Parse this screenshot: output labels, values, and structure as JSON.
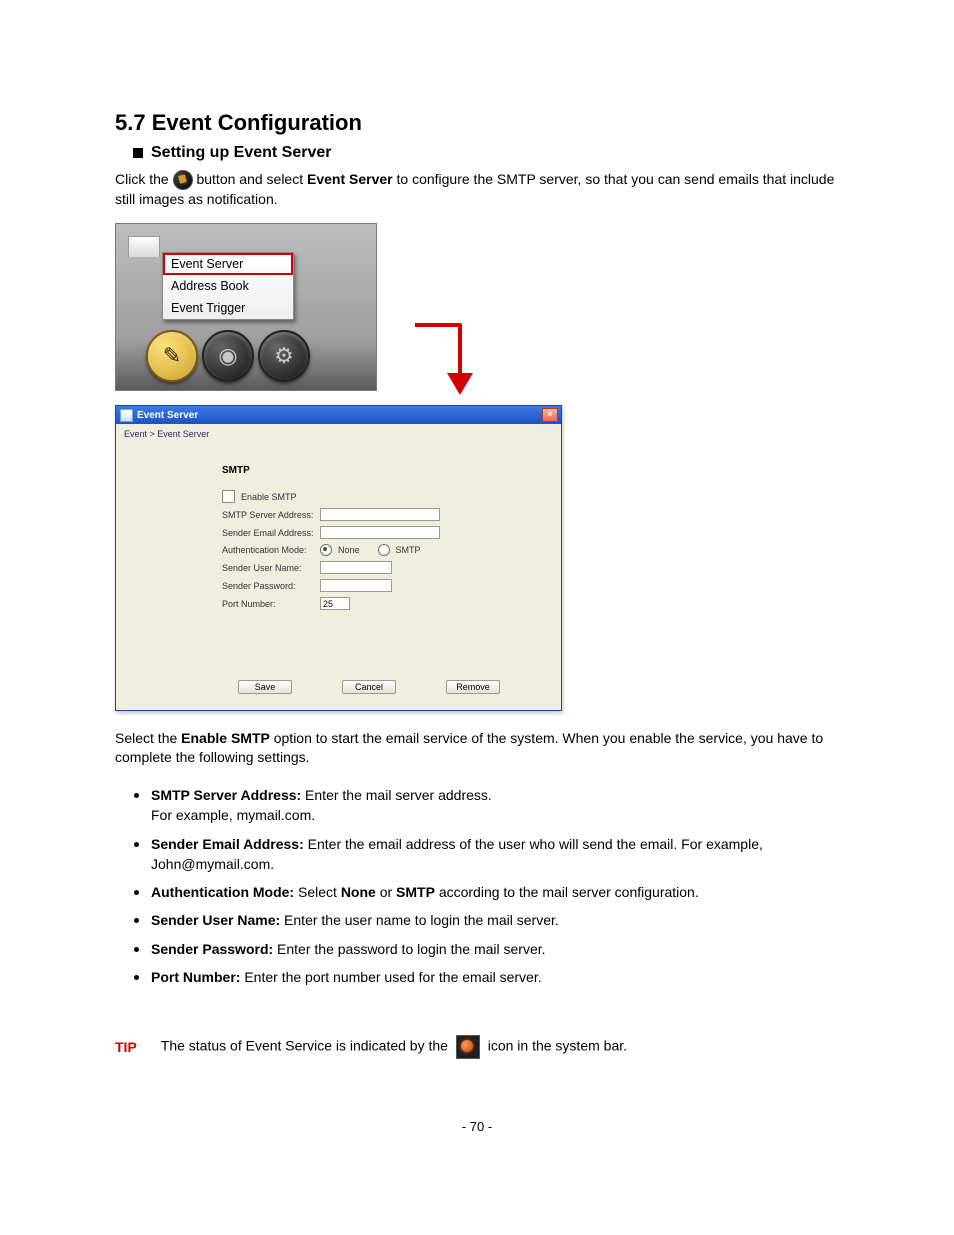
{
  "section": {
    "title": "5.7  Event Configuration",
    "sub_title": "Setting up Event Server",
    "intro_pre": "Click the ",
    "intro_mid": " button and select ",
    "intro_menu": "Event Server",
    "intro_post": " to configure the SMTP server, so that you can send emails that include still images as notification."
  },
  "menu": {
    "items": [
      "Event Server",
      "Address Book",
      "Event Trigger"
    ],
    "selected_index": 0
  },
  "dialog": {
    "title": "Event Server",
    "close_label": "×",
    "breadcrumb": "Event > Event Server",
    "smtp_heading": "SMTP",
    "enable_label": "Enable SMTP",
    "enable_checked": false,
    "server_addr_label": "SMTP Server Address:",
    "server_addr_value": "",
    "sender_email_label": "Sender Email Address:",
    "sender_email_value": "",
    "auth_mode_label": "Authentication Mode:",
    "auth_none_label": "None",
    "auth_smtp_label": "SMTP",
    "auth_selected": "None",
    "user_label": "Sender User Name:",
    "user_value": "",
    "pass_label": "Sender Password:",
    "pass_value": "",
    "port_label": "Port Number:",
    "port_value": "25",
    "buttons": {
      "save": "Save",
      "cancel": "Cancel",
      "remove": "Remove"
    }
  },
  "post_dialog": {
    "para_pre": "Select the ",
    "para_bold": "Enable SMTP",
    "para_post": " option to start the email service of the system. When you enable the service, you have to complete the following settings."
  },
  "list": [
    {
      "term": "SMTP Server Address:",
      "desc": " Enter the mail server address.",
      "extra": "For example, mymail.com."
    },
    {
      "term": "Sender Email Address:",
      "desc": " Enter the email address of the user who will send the email. For example, John@mymail.com.",
      "extra": ""
    },
    {
      "term": "Authentication Mode:",
      "desc_pre": " Select ",
      "b1": "None",
      "mid": " or ",
      "b2": "SMTP",
      "desc_post": " according to the mail server configuration."
    },
    {
      "term": "Sender User Name:",
      "desc": " Enter the user name to login the mail server."
    },
    {
      "term": "Sender Password:",
      "desc": " Enter the password to login the mail server."
    },
    {
      "term": "Port Number:",
      "desc": " Enter the port number used for the email server."
    }
  ],
  "tip": {
    "label": "TIP",
    "text_pre": "The status of Event Service is indicated by the ",
    "text_post": " icon in the system bar."
  },
  "page_number": "- 70 -"
}
